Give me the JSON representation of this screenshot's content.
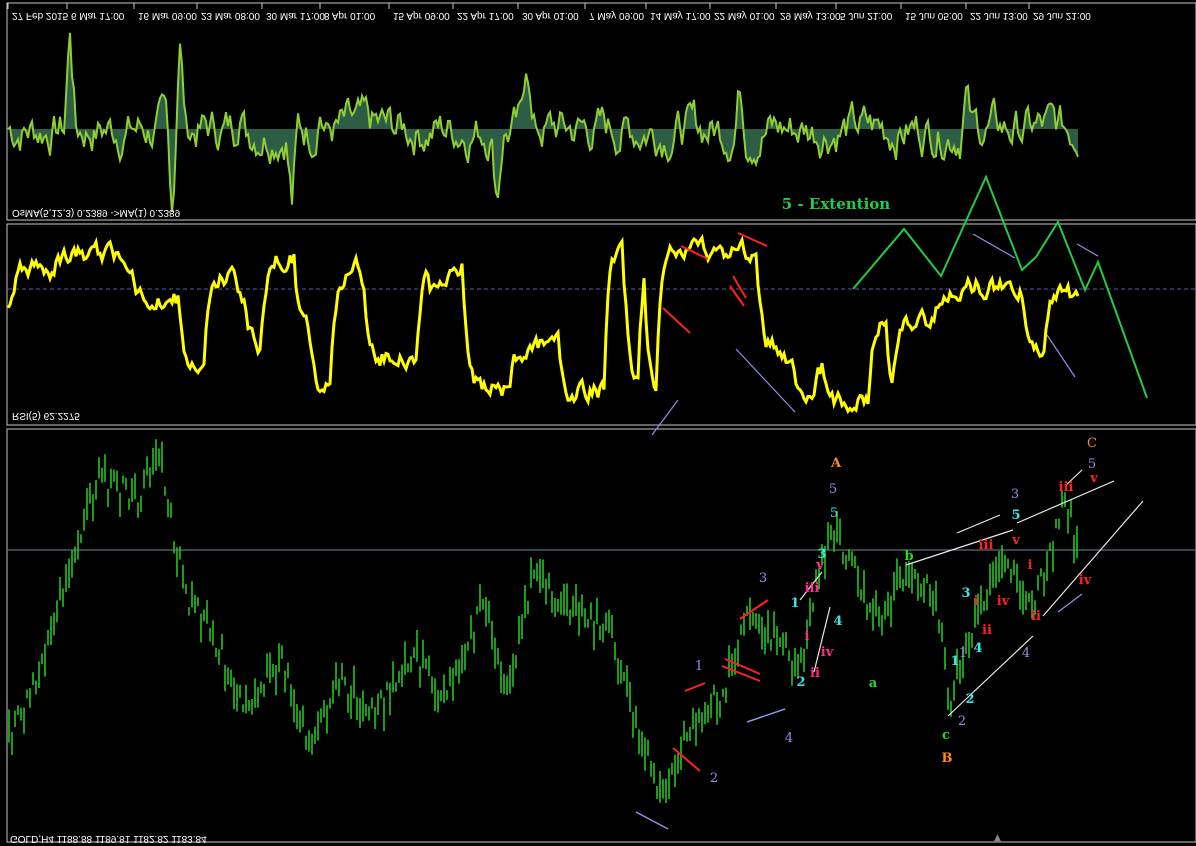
{
  "window": {
    "symbol_label": "GOLD,H4 1188.88 1189.81 1182.82 1183.84",
    "osma_label": "OsMA(5,12,3) 0.2389 ->MA(1) 0.2389",
    "rsi_label": "RSI(5) 62.2275",
    "time_axis": [
      "27 Feb 2015",
      "6 Mar 17:00",
      "16 Mar 09:00",
      "23 Mar 08:00",
      "30 Mar 17:00",
      "8 Apr 01:00",
      "15 Apr 09:00",
      "22 Apr 17:00",
      "30 Apr 01:00",
      "7 May 09:00",
      "14 May 17:00",
      "22 May 01:00",
      "29 May 13:00",
      "5 Jun 21:00",
      "15 Jun 05:00",
      "22 Jun 13:00",
      "29 Jun 21:00"
    ]
  },
  "annotations": {
    "extension_text": "5 - Extention",
    "waves": [
      {
        "t": "A",
        "c": "#ff8c1a",
        "b": true
      },
      {
        "t": "5",
        "c": "#8f8fe8"
      },
      {
        "t": "5",
        "c": "#3fe6e6"
      },
      {
        "t": "3",
        "c": "#3fe6e6",
        "b": true
      },
      {
        "t": "v",
        "c": "#ff2a8a",
        "b": true
      },
      {
        "t": "iii",
        "c": "#ff2a8a",
        "b": true
      },
      {
        "t": "i",
        "c": "#ff2a8a",
        "b": true
      },
      {
        "t": "iv",
        "c": "#ff2a8a",
        "b": true
      },
      {
        "t": "ii",
        "c": "#ff2a8a",
        "b": true
      },
      {
        "t": "4",
        "c": "#3fe6e6",
        "b": true
      },
      {
        "t": "1",
        "c": "#3fe6e6",
        "b": true
      },
      {
        "t": "2",
        "c": "#3fe6e6",
        "b": true
      },
      {
        "t": "3",
        "c": "#8f8fe8"
      },
      {
        "t": "1",
        "c": "#8f8fe8"
      },
      {
        "t": "2",
        "c": "#8f8fe8"
      },
      {
        "t": "4",
        "c": "#8f8fe8"
      },
      {
        "t": "a",
        "c": "#22dd22",
        "b": true
      },
      {
        "t": "b",
        "c": "#22dd22",
        "b": true
      },
      {
        "t": "c",
        "c": "#22dd22",
        "b": true
      },
      {
        "t": "B",
        "c": "#ff8c1a",
        "b": true
      },
      {
        "t": "1",
        "c": "#3fe6e6",
        "b": true
      },
      {
        "t": "1",
        "c": "#8f8fe8"
      },
      {
        "t": "2",
        "c": "#3fe6e6",
        "b": true
      },
      {
        "t": "2",
        "c": "#8f8fe8"
      },
      {
        "t": "3",
        "c": "#3fe6e6",
        "b": true
      },
      {
        "t": "4",
        "c": "#3fe6e6",
        "b": true
      },
      {
        "t": "i",
        "c": "#ff2020",
        "b": true
      },
      {
        "t": "ii",
        "c": "#ff2020",
        "b": true
      },
      {
        "t": "iii",
        "c": "#ff2020",
        "b": true
      },
      {
        "t": "iv",
        "c": "#ff2020",
        "b": true
      },
      {
        "t": "v",
        "c": "#ff2020",
        "b": true
      },
      {
        "t": "3",
        "c": "#8f8fe8"
      },
      {
        "t": "5",
        "c": "#3fe6e6",
        "b": true
      },
      {
        "t": "4",
        "c": "#8f8fe8"
      },
      {
        "t": "i",
        "c": "#ff2020",
        "b": true
      },
      {
        "t": "ii",
        "c": "#ff2020",
        "b": true
      },
      {
        "t": "iii",
        "c": "#ff2020",
        "b": true
      },
      {
        "t": "iv",
        "c": "#ff2020",
        "b": true
      },
      {
        "t": "v",
        "c": "#ff2020",
        "b": true
      },
      {
        "t": "C",
        "c": "#ff8c1a"
      },
      {
        "t": "5",
        "c": "#8f8fe8"
      }
    ]
  },
  "chart_data": [
    {
      "type": "area",
      "panel": "osma",
      "title": "OsMA(5,12,3) 0.2389 ->MA(1) 0.2389",
      "value": 0.2389
    },
    {
      "type": "line",
      "panel": "rsi",
      "title": "RSI(5) 62.2275",
      "value": 62.2275
    },
    {
      "type": "bar",
      "panel": "price",
      "title": "GOLD,H4",
      "ohlc": {
        "open": 1188.88,
        "high": 1189.81,
        "low": 1182.82,
        "close": 1183.84
      }
    }
  ],
  "colors": {
    "price": "#22c422",
    "osma_line": "#8fcf32",
    "osma_fill": "#2e5d46",
    "rsi": "#ffff00",
    "grid": "#c8c8c8",
    "ext": "#22cc44",
    "level": "#6e8aa0"
  }
}
